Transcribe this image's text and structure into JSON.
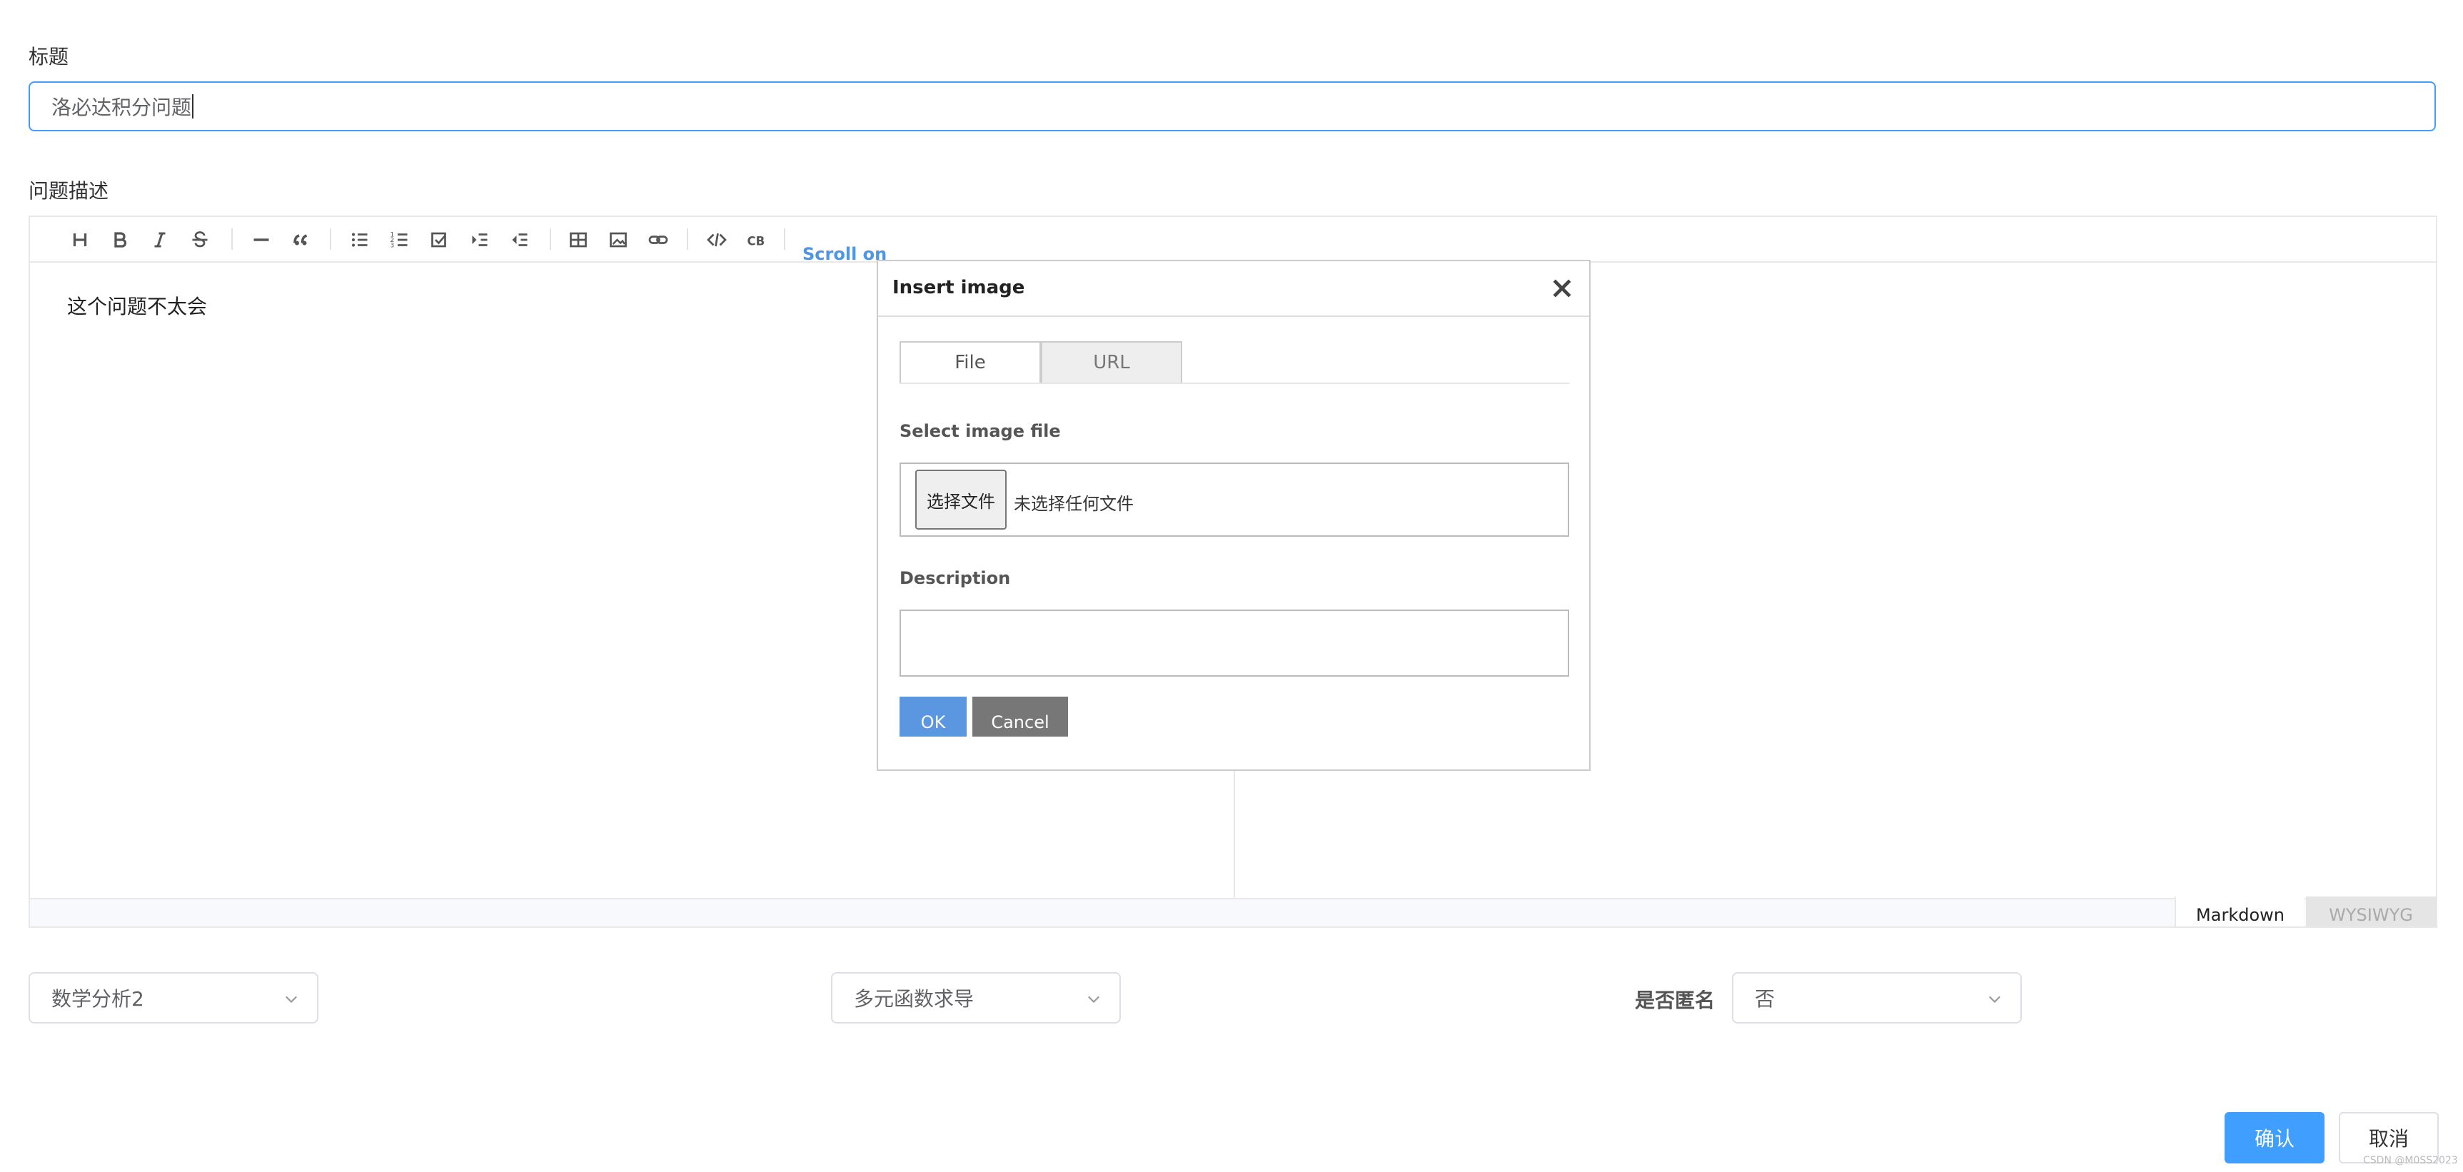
{
  "form": {
    "title_label": "标题",
    "title_value": "洛必达积分问题",
    "desc_label": "问题描述"
  },
  "editor": {
    "toolbar": [
      {
        "name": "heading-icon"
      },
      {
        "name": "bold-icon"
      },
      {
        "name": "italic-icon"
      },
      {
        "name": "strike-icon"
      },
      {
        "name": "hr-icon"
      },
      {
        "name": "quote-icon"
      },
      {
        "name": "bullet-list-icon"
      },
      {
        "name": "ordered-list-icon"
      },
      {
        "name": "task-list-icon"
      },
      {
        "name": "indent-icon"
      },
      {
        "name": "outdent-icon"
      },
      {
        "name": "table-icon"
      },
      {
        "name": "image-icon"
      },
      {
        "name": "link-icon"
      },
      {
        "name": "code-icon"
      },
      {
        "name": "codeblock-icon"
      }
    ],
    "scroll_label": "Scroll on",
    "content": "这个问题不太会",
    "mode_markdown": "Markdown",
    "mode_wysiwyg": "WYSIWYG"
  },
  "dialog": {
    "title": "Insert image",
    "tab_file": "File",
    "tab_url": "URL",
    "select_label": "Select image file",
    "choose_btn": "选择文件",
    "no_file": "未选择任何文件",
    "desc_label": "Description",
    "ok": "OK",
    "cancel": "Cancel"
  },
  "selects": {
    "subject": "数学分析2",
    "topic": "多元函数求导",
    "anon_label": "是否匿名",
    "anon_value": "否"
  },
  "actions": {
    "confirm": "确认",
    "cancel": "取消"
  },
  "watermark": "CSDN @M0SS2023",
  "colors": {
    "primary": "#409eff",
    "dialog_ok": "#5b96e0",
    "dialog_cancel": "#777777"
  }
}
